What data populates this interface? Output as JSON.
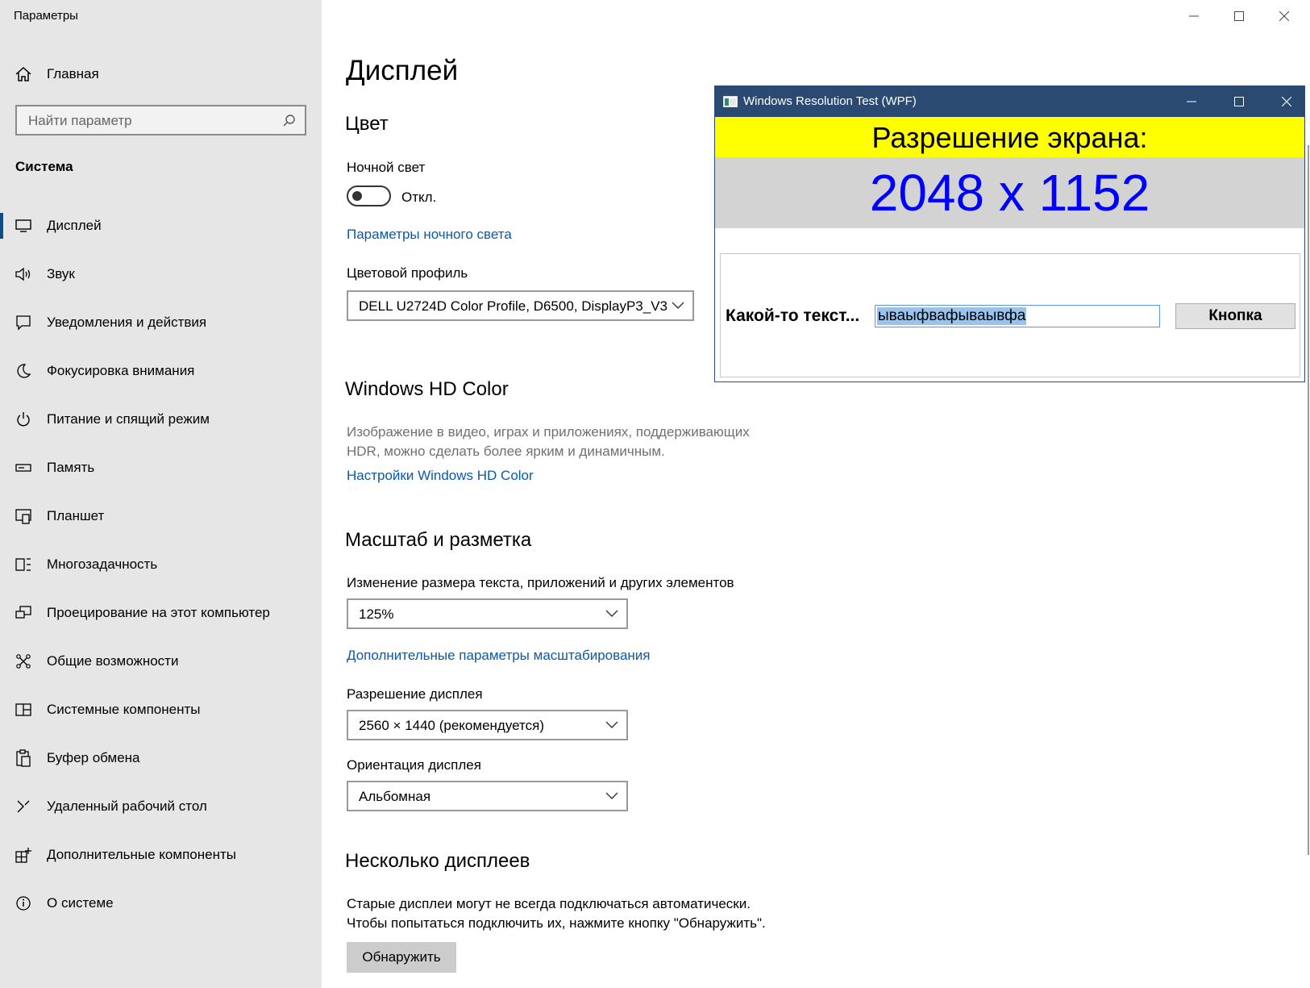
{
  "window": {
    "app_title": "Параметры"
  },
  "sidebar": {
    "home_label": "Главная",
    "search_placeholder": "Найти параметр",
    "section_title": "Система",
    "items": [
      {
        "label": "Дисплей",
        "icon": "monitor-icon",
        "active": true
      },
      {
        "label": "Звук",
        "icon": "speaker-icon"
      },
      {
        "label": "Уведомления и действия",
        "icon": "notification-icon"
      },
      {
        "label": "Фокусировка внимания",
        "icon": "moon-icon"
      },
      {
        "label": "Питание и спящий режим",
        "icon": "power-icon"
      },
      {
        "label": "Память",
        "icon": "storage-icon"
      },
      {
        "label": "Планшет",
        "icon": "tablet-icon"
      },
      {
        "label": "Многозадачность",
        "icon": "multitasking-icon"
      },
      {
        "label": "Проецирование на этот компьютер",
        "icon": "projecting-icon"
      },
      {
        "label": "Общие возможности",
        "icon": "shared-experiences-icon"
      },
      {
        "label": "Системные компоненты",
        "icon": "system-components-icon"
      },
      {
        "label": "Буфер обмена",
        "icon": "clipboard-icon"
      },
      {
        "label": "Удаленный рабочий стол",
        "icon": "remote-desktop-icon"
      },
      {
        "label": "Дополнительные компоненты",
        "icon": "optional-features-icon"
      },
      {
        "label": "О системе",
        "icon": "info-icon"
      }
    ]
  },
  "main": {
    "page_title": "Дисплей",
    "color": {
      "heading": "Цвет",
      "night_light_label": "Ночной свет",
      "night_light_state": "Откл.",
      "night_light_link": "Параметры ночного света",
      "profile_label": "Цветовой профиль",
      "profile_value": "DELL U2724D Color Profile, D6500, DisplayP3_V3"
    },
    "hd_color": {
      "heading": "Windows HD Color",
      "description_line1": "Изображение в видео, играх и приложениях, поддерживающих",
      "description_line2": "HDR, можно сделать более ярким и динамичным.",
      "link": "Настройки Windows HD Color"
    },
    "scale": {
      "heading": "Масштаб и разметка",
      "size_label": "Изменение размера текста, приложений и других элементов",
      "size_value": "125%",
      "advanced_link": "Дополнительные параметры масштабирования",
      "resolution_label": "Разрешение дисплея",
      "resolution_value": "2560 × 1440 (рекомендуется)",
      "orientation_label": "Ориентация дисплея",
      "orientation_value": "Альбомная"
    },
    "multi": {
      "heading": "Несколько дисплеев",
      "description_line1": "Старые дисплеи могут не всегда подключаться автоматически.",
      "description_line2": "Чтобы попытаться подключить их, нажмите кнопку \"Обнаружить\".",
      "detect_button": "Обнаружить"
    }
  },
  "wpf_window": {
    "title": "Windows Resolution Test (WPF)",
    "banner": "Разрешение экрана:",
    "resolution": "2048 x 1152",
    "label": "Какой-то текст...",
    "input_value": "ываыфвафываывфа",
    "button": "Кнопка",
    "colors": {
      "titlebar": "#2b4a72",
      "banner": "#ffff00",
      "resolution_text": "#0000ff",
      "resolution_bg": "#d3d3d3"
    }
  }
}
